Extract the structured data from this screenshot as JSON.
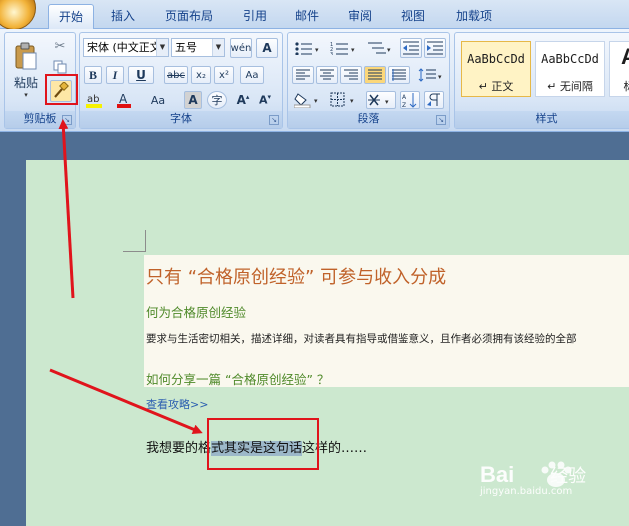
{
  "ribbon": {
    "tabs": [
      "开始",
      "插入",
      "页面布局",
      "引用",
      "邮件",
      "审阅",
      "视图",
      "加载项"
    ],
    "clipboard": {
      "label": "剪贴板",
      "paste_label": "粘贴"
    },
    "font": {
      "label": "字体",
      "font_name": "宋体 (中文正文)",
      "font_size": "五号",
      "bold": "B",
      "italic": "I",
      "underline": "U",
      "strike": "abc",
      "subscript": "x₂",
      "superscript": "x²",
      "grow": "A",
      "shrink": "A",
      "change_case": "Aa",
      "char_border": "A",
      "enclose": "字"
    },
    "paragraph": {
      "label": "段落"
    },
    "styles": {
      "label": "样式",
      "items": [
        {
          "sample": "AaBbCcDd",
          "name": "↵ 正文"
        },
        {
          "sample": "AaBbCcDd",
          "name": "↵ 无间隔"
        },
        {
          "sample": "A",
          "name": "标"
        }
      ]
    }
  },
  "document": {
    "heading": "只有  “合格原创经验”  可参与收入分成",
    "subheading1": "何为合格原创经验",
    "body1": "要求与生活密切相关，描述详细，对读者具有指导或借鉴意义，且作者必须拥有该经验的全部",
    "subheading2": "如何分享一篇 “合格原创经验” ？",
    "link": "查看攻略>>",
    "line_before": "我想要的格",
    "line_selected": "式其实是这句话",
    "line_after": "这样的……"
  },
  "watermark": {
    "brand": "Bai",
    "brand2": "经验",
    "url": "jingyan.baidu.com"
  },
  "colors": {
    "accent_red": "#e0141c",
    "doc_background": "#cce8cf",
    "heading_color": "#c0622a",
    "subheading_color": "#4f8a2a",
    "link_color": "#2a5db0",
    "selection": "#9cb8c9"
  }
}
